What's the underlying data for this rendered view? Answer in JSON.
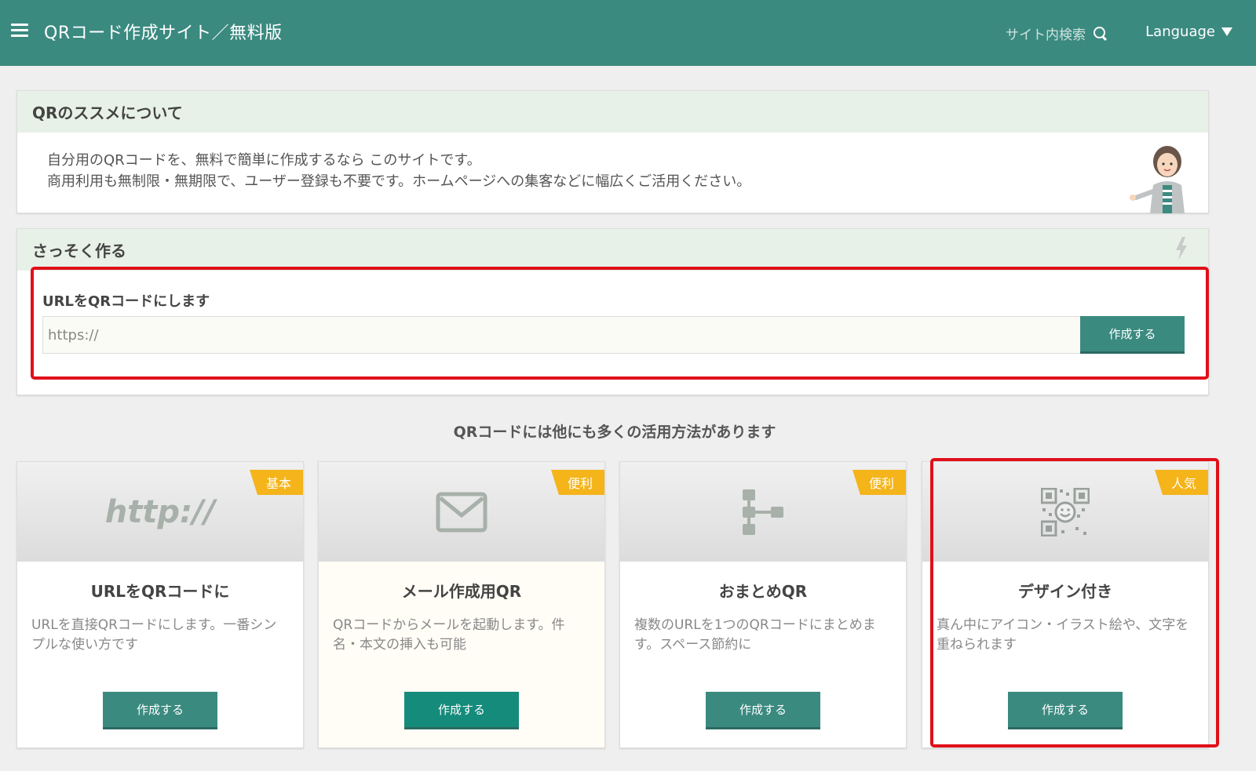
{
  "header": {
    "title": "QRコード作成サイト／無料版",
    "search_label": "サイト内検索",
    "language_label": "Language"
  },
  "about": {
    "heading": "QRのススメについて",
    "line1": "自分用のQRコードを、無料で簡単に作成するなら このサイトです。",
    "line2": "商用利用も無制限・無期限で、ユーザー登録も不要です。ホームページへの集客などに幅広くご活用ください。"
  },
  "quick": {
    "heading": "さっそく作る",
    "url_label": "URLをQRコードにします",
    "url_placeholder": "https://",
    "submit_label": "作成する"
  },
  "section_heading": "QRコードには他にも多くの活用方法があります",
  "cards": [
    {
      "badge": "基本",
      "icon_text": "http://",
      "title": "URLをQRコードに",
      "desc": "URLを直接QRコードにします。一番シンプルな使い方です",
      "button": "作成する"
    },
    {
      "badge": "便利",
      "title": "メール作成用QR",
      "desc": "QRコードからメールを起動します。件名・本文の挿入も可能",
      "button": "作成する"
    },
    {
      "badge": "便利",
      "title": "おまとめQR",
      "desc": "複数のURLを1つのQRコードにまとめます。スペース節約に",
      "button": "作成する"
    },
    {
      "badge": "人気",
      "title": "デザイン付き",
      "desc": "真ん中にアイコン・イラスト絵や、文字を重ねられます",
      "button": "作成する"
    }
  ],
  "colors": {
    "header_bg": "#3b8a80",
    "panel_head_bg": "#e8f1e8",
    "badge": "#f4b41a",
    "highlight": "#e0101a"
  }
}
